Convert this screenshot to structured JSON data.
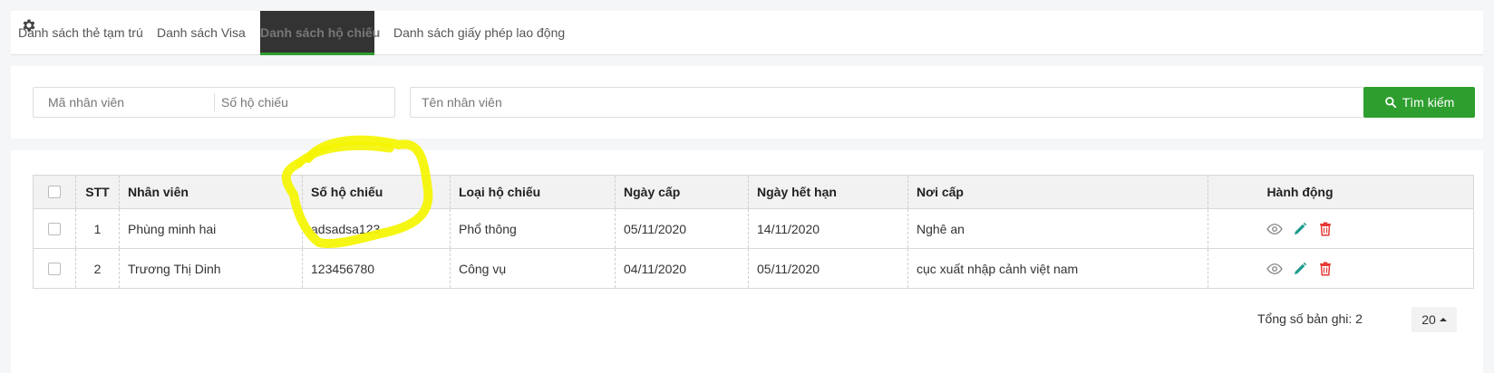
{
  "tabs": [
    {
      "label": "Danh sách thẻ tạm trú"
    },
    {
      "label": "Danh sách Visa"
    },
    {
      "label": "Danh sách hộ chiếu"
    },
    {
      "label": "Danh sách giấy phép lao động"
    }
  ],
  "search": {
    "employee_code_placeholder": "Mã nhân viên",
    "passport_no_placeholder": "Số hộ chiếu",
    "employee_name_placeholder": "Tên nhân viên",
    "button_label": "Tìm kiếm"
  },
  "table": {
    "headers": {
      "stt": "STT",
      "employee": "Nhân viên",
      "passport_no": "Số hộ chiếu",
      "passport_type": "Loại hộ chiếu",
      "issue_date": "Ngày cấp",
      "expiry_date": "Ngày hết hạn",
      "issue_place": "Nơi cấp",
      "actions": "Hành động"
    },
    "rows": [
      {
        "stt": "1",
        "employee": "Phùng minh hai",
        "passport_no": "adsadsa123",
        "passport_type": "Phổ thông",
        "issue_date": "05/11/2020",
        "expiry_date": "14/11/2020",
        "issue_place": "Nghê an"
      },
      {
        "stt": "2",
        "employee": "Trương Thị Dinh",
        "passport_no": "123456780",
        "passport_type": "Công vụ",
        "issue_date": "04/11/2020",
        "expiry_date": "05/11/2020",
        "issue_place": "cục xuất nhập cảnh việt nam"
      }
    ]
  },
  "footer": {
    "total_label": "Tổng số bản ghi: 2",
    "page_size": "20"
  },
  "colors": {
    "primary_green": "#2e9e2e",
    "edit_teal": "#1a9a8a",
    "delete_red": "#e53935",
    "highlight_yellow": "#f5f500"
  },
  "icons": [
    "gear-icon",
    "search-icon",
    "eye-icon",
    "pencil-icon",
    "trash-icon",
    "caret-up-icon"
  ]
}
